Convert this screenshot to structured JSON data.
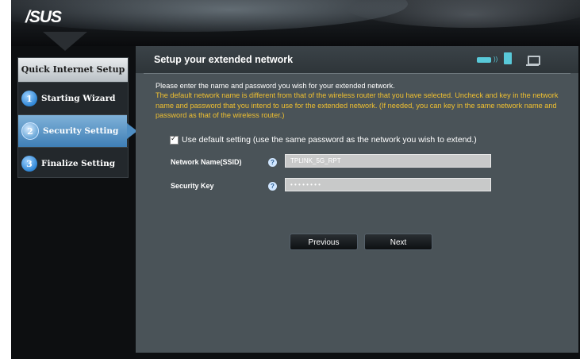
{
  "header": {
    "logo": "/SUS"
  },
  "sidebar": {
    "title": "Quick Internet Setup",
    "items": [
      {
        "num": "1",
        "label": "Starting Wizard"
      },
      {
        "num": "2",
        "label": "Security Setting"
      },
      {
        "num": "3",
        "label": "Finalize Setting"
      }
    ]
  },
  "main": {
    "title": "Setup your extended network",
    "desc_white": "Please enter the name and password you wish for your extended network.",
    "desc_yellow": "The default network name is different from that of the wireless router that you have selected. Uncheck and key in the network name and password that you intend to use for the extended network. (If needed, you can key in the same network name and password as that of the wireless router.)",
    "checkbox_label": "Use default setting (use the same password as the network you wish to extend.)",
    "network_name_label": "Network Name(SSID)",
    "network_name_value": "TPLINK_5G_RPT",
    "security_key_label": "Security Key",
    "security_key_value": "• • • • • • • •",
    "help": "?",
    "previous_label": "Previous",
    "next_label": "Next"
  },
  "colors": {
    "accent_blue": "#3f7fb6",
    "icon_teal": "#59c9d9",
    "warning_yellow": "#f0c030"
  }
}
